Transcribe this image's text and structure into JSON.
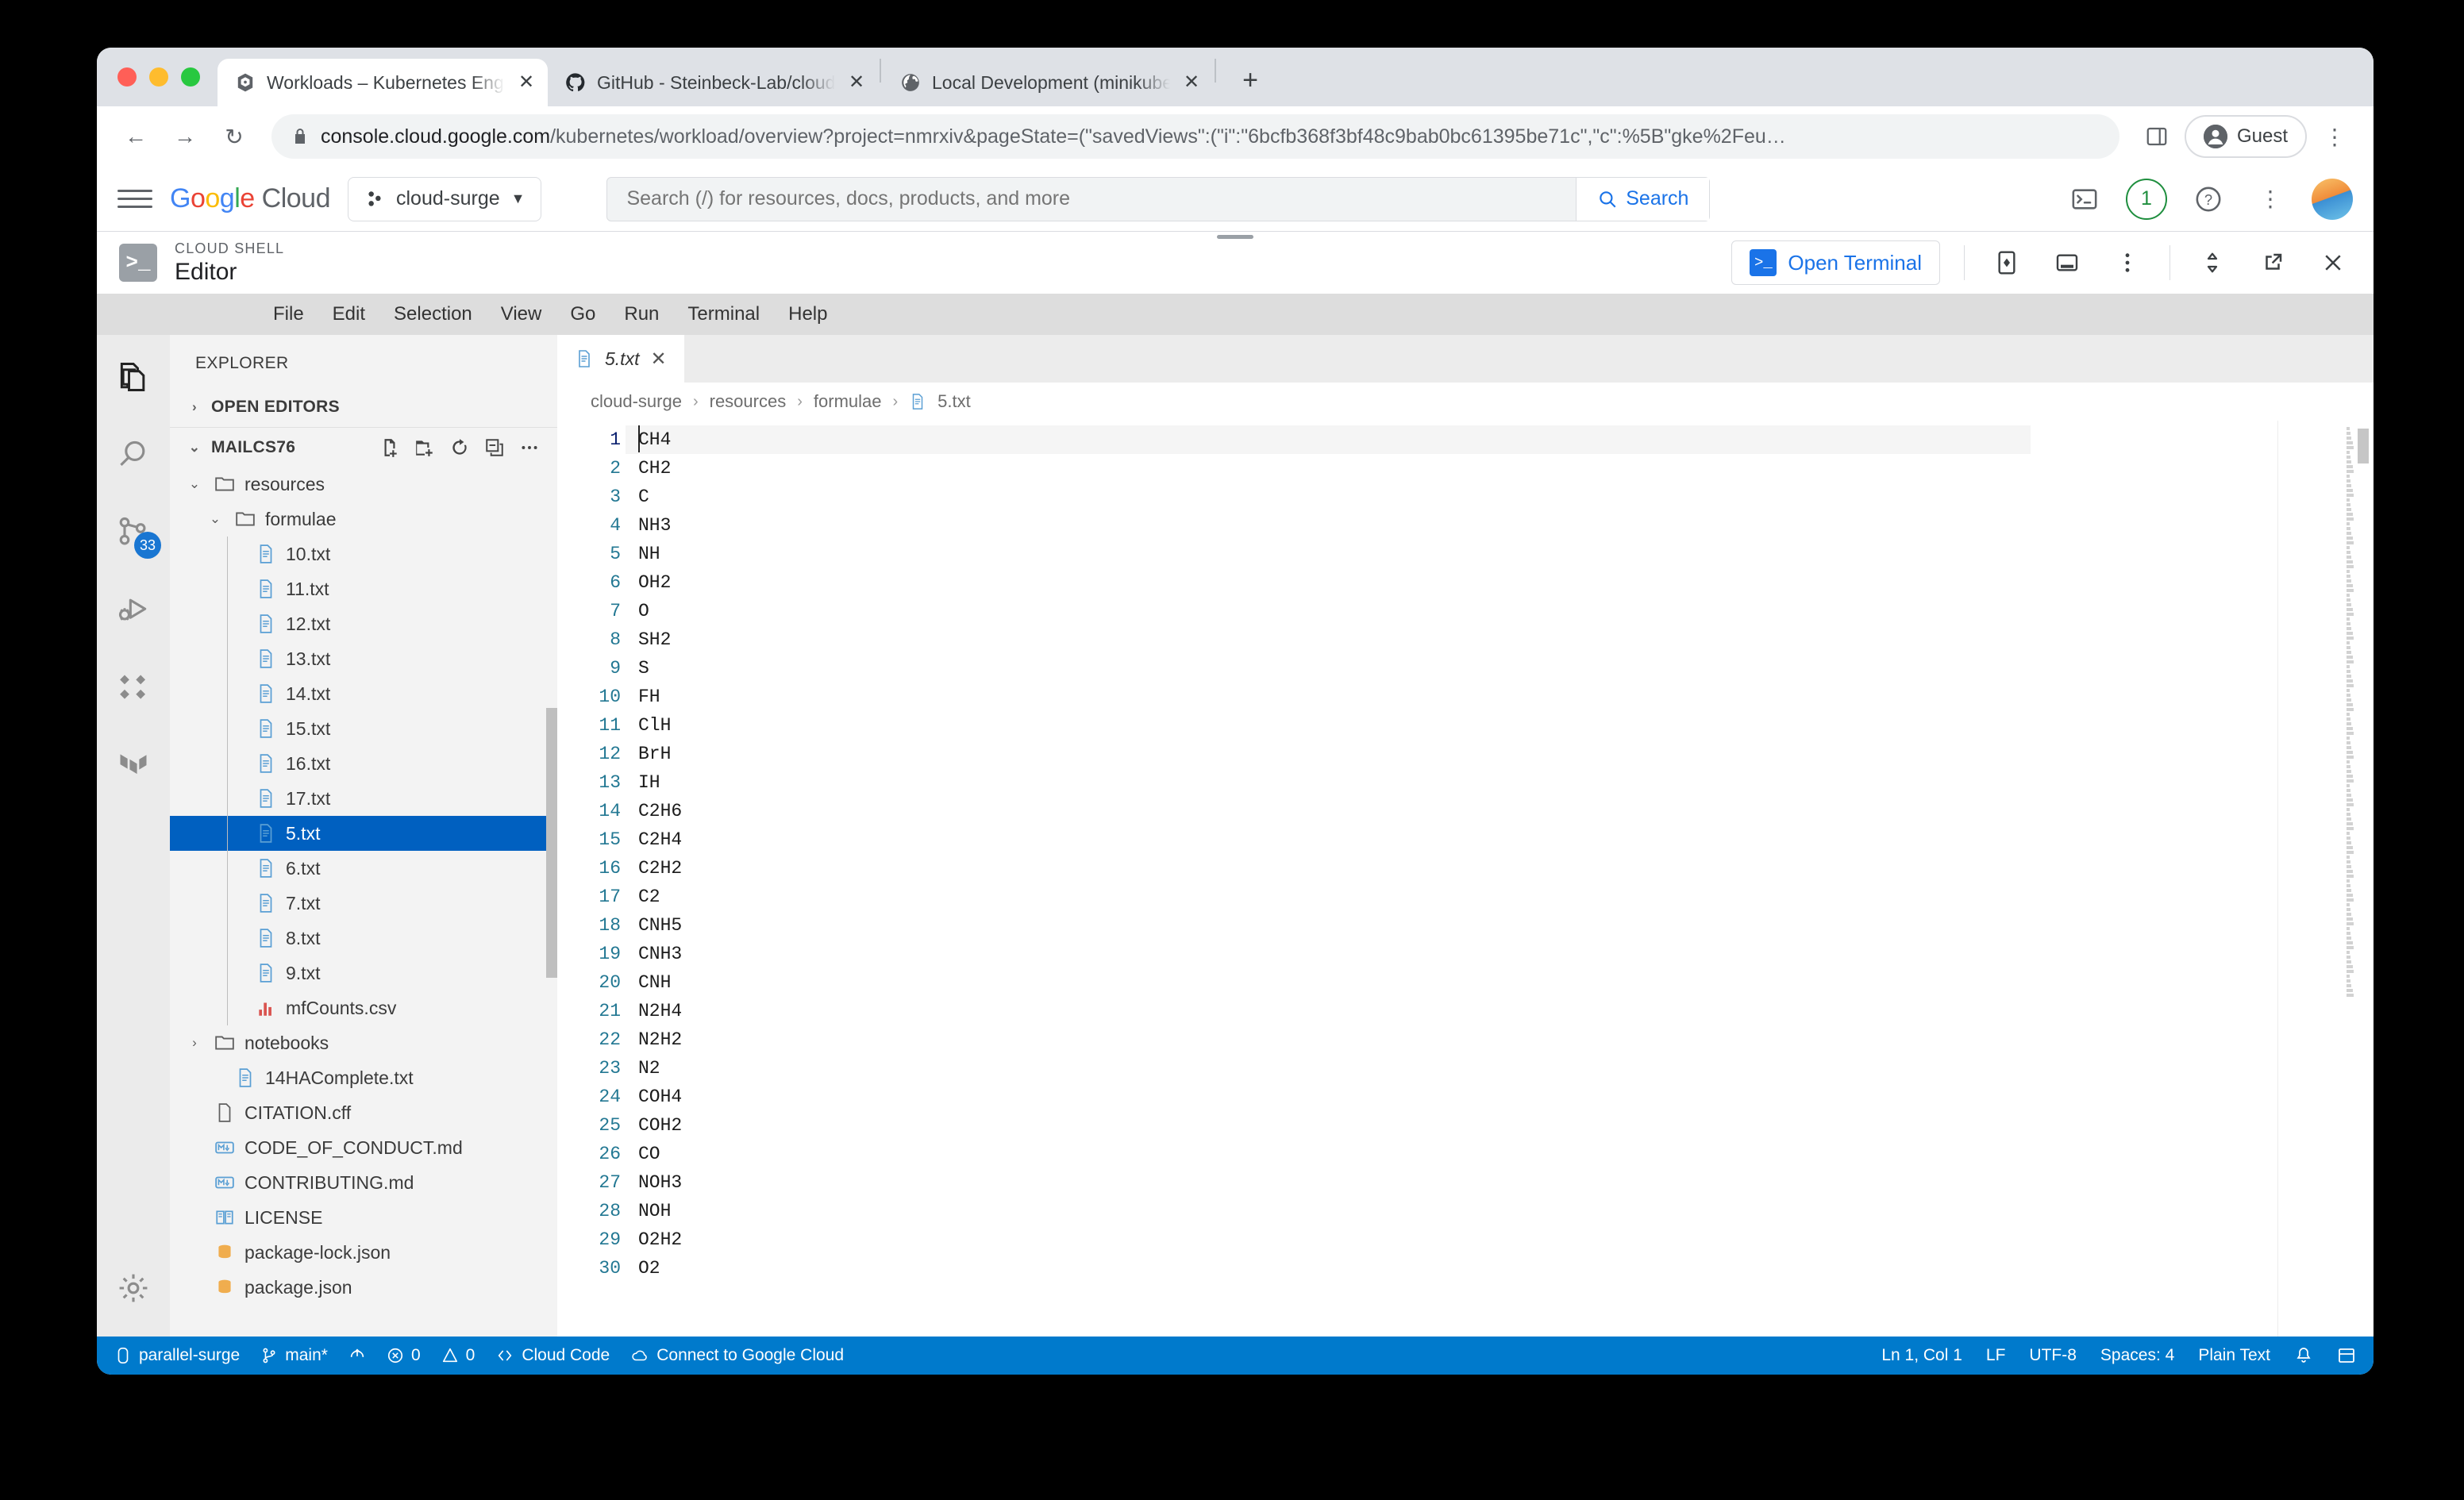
{
  "browser": {
    "tabs": [
      {
        "title": "Workloads – Kubernetes Engine",
        "icon": "kubernetes-icon",
        "active": true
      },
      {
        "title": "GitHub - Steinbeck-Lab/cloud-",
        "icon": "github-icon",
        "active": false
      },
      {
        "title": "Local Development (minikube)",
        "icon": "globe-icon",
        "active": false
      }
    ],
    "new_tab_label": "+",
    "close_label": "✕",
    "back_label": "←",
    "forward_label": "→",
    "reload_label": "↻",
    "url_host": "console.cloud.google.com",
    "url_path": "/kubernetes/workload/overview?project=nmrxiv&pageState=(\"savedViews\":(\"i\":\"6bcfb368f3bf48c9bab0bc61395be71c\",\"c\":%5B\"gke%2Feu…",
    "profile_label": "Guest",
    "menu_label": "⋮"
  },
  "gcp": {
    "logo_google": "Google",
    "logo_cloud": "Cloud",
    "project": "cloud-surge",
    "project_caret": "▼",
    "search_placeholder": "Search (/) for resources, docs, products, and more",
    "search_button": "Search",
    "notification_count": "1",
    "help_label": "?",
    "more_label": "⋮"
  },
  "cloudshell": {
    "eyebrow": "CLOUD SHELL",
    "title": "Editor",
    "open_terminal": "Open Terminal",
    "tools": [
      "preview-icon",
      "new-window-icon",
      "more-vert-icon",
      "expand-collapse-icon",
      "open-new-icon",
      "close-icon"
    ]
  },
  "menubar": [
    "File",
    "Edit",
    "Selection",
    "View",
    "Go",
    "Run",
    "Terminal",
    "Help"
  ],
  "activitybar": [
    {
      "name": "explorer-icon",
      "active": true,
      "badge": ""
    },
    {
      "name": "search-icon",
      "active": false,
      "badge": ""
    },
    {
      "name": "source-control-icon",
      "active": false,
      "badge": "33"
    },
    {
      "name": "run-and-debug-icon",
      "active": false,
      "badge": ""
    },
    {
      "name": "extensions-icon",
      "active": false,
      "badge": ""
    },
    {
      "name": "terraform-icon",
      "active": false,
      "badge": ""
    },
    {
      "name": "settings-gear-icon",
      "active": false,
      "badge": ""
    }
  ],
  "explorer": {
    "title": "EXPLORER",
    "open_editors": "OPEN EDITORS",
    "workspace": "MAILCS76",
    "actions": [
      "new-file-icon",
      "new-folder-icon",
      "refresh-icon",
      "collapse-all-icon",
      "more-actions-icon"
    ],
    "tree": [
      {
        "label": "resources",
        "indent": 1,
        "type": "folder",
        "expanded": true,
        "selected": false
      },
      {
        "label": "formulae",
        "indent": 2,
        "type": "folder",
        "expanded": true,
        "selected": false
      },
      {
        "label": "10.txt",
        "indent": 3,
        "type": "txt",
        "selected": false
      },
      {
        "label": "11.txt",
        "indent": 3,
        "type": "txt",
        "selected": false
      },
      {
        "label": "12.txt",
        "indent": 3,
        "type": "txt",
        "selected": false
      },
      {
        "label": "13.txt",
        "indent": 3,
        "type": "txt",
        "selected": false
      },
      {
        "label": "14.txt",
        "indent": 3,
        "type": "txt",
        "selected": false
      },
      {
        "label": "15.txt",
        "indent": 3,
        "type": "txt",
        "selected": false
      },
      {
        "label": "16.txt",
        "indent": 3,
        "type": "txt",
        "selected": false
      },
      {
        "label": "17.txt",
        "indent": 3,
        "type": "txt",
        "selected": false
      },
      {
        "label": "5.txt",
        "indent": 3,
        "type": "txt",
        "selected": true
      },
      {
        "label": "6.txt",
        "indent": 3,
        "type": "txt",
        "selected": false
      },
      {
        "label": "7.txt",
        "indent": 3,
        "type": "txt",
        "selected": false
      },
      {
        "label": "8.txt",
        "indent": 3,
        "type": "txt",
        "selected": false
      },
      {
        "label": "9.txt",
        "indent": 3,
        "type": "txt",
        "selected": false
      },
      {
        "label": "mfCounts.csv",
        "indent": 3,
        "type": "csv",
        "selected": false
      },
      {
        "label": "notebooks",
        "indent": 1,
        "type": "folder",
        "expanded": false,
        "selected": false
      },
      {
        "label": "14HAComplete.txt",
        "indent": 2,
        "type": "txt",
        "selected": false
      },
      {
        "label": "CITATION.cff",
        "indent": 1,
        "type": "plain",
        "selected": false
      },
      {
        "label": "CODE_OF_CONDUCT.md",
        "indent": 1,
        "type": "md",
        "selected": false
      },
      {
        "label": "CONTRIBUTING.md",
        "indent": 1,
        "type": "md",
        "selected": false
      },
      {
        "label": "LICENSE",
        "indent": 1,
        "type": "license",
        "selected": false
      },
      {
        "label": "package-lock.json",
        "indent": 1,
        "type": "json",
        "selected": false
      },
      {
        "label": "package.json",
        "indent": 1,
        "type": "json",
        "selected": false
      }
    ]
  },
  "editor": {
    "tab_label": "5.txt",
    "tab_close": "✕",
    "breadcrumb": [
      "cloud-surge",
      "resources",
      "formulae",
      "5.txt"
    ],
    "breadcrumb_sep": "›",
    "lines": [
      "CH4",
      "CH2",
      "C",
      "NH3",
      "NH",
      "OH2",
      "O",
      "SH2",
      "S",
      "FH",
      "ClH",
      "BrH",
      "IH",
      "C2H6",
      "C2H4",
      "C2H2",
      "C2",
      "CNH5",
      "CNH3",
      "CNH",
      "N2H4",
      "N2H2",
      "N2",
      "COH4",
      "COH2",
      "CO",
      "NOH3",
      "NOH",
      "O2H2",
      "O2"
    ]
  },
  "statusbar": {
    "left": [
      {
        "icon": "remote-icon",
        "label": "parallel-surge"
      },
      {
        "icon": "branch-icon",
        "label": "main*"
      },
      {
        "icon": "sync-icon",
        "label": ""
      },
      {
        "icon": "error-icon",
        "label": "0"
      },
      {
        "icon": "warning-icon",
        "label": "0"
      },
      {
        "icon": "code-icon",
        "label": "Cloud Code"
      },
      {
        "icon": "cloud-icon",
        "label": "Connect to Google Cloud"
      }
    ],
    "right": [
      {
        "icon": "",
        "label": "Ln 1, Col 1"
      },
      {
        "icon": "",
        "label": "LF"
      },
      {
        "icon": "",
        "label": "UTF-8"
      },
      {
        "icon": "",
        "label": "Spaces: 4"
      },
      {
        "icon": "",
        "label": "Plain Text"
      },
      {
        "icon": "bell-icon",
        "label": ""
      },
      {
        "icon": "panel-icon",
        "label": ""
      }
    ]
  },
  "colors": {
    "accent_blue": "#1a73e8",
    "status_blue": "#007acc",
    "selection_blue": "#0060c0",
    "line_number": "#237893"
  }
}
